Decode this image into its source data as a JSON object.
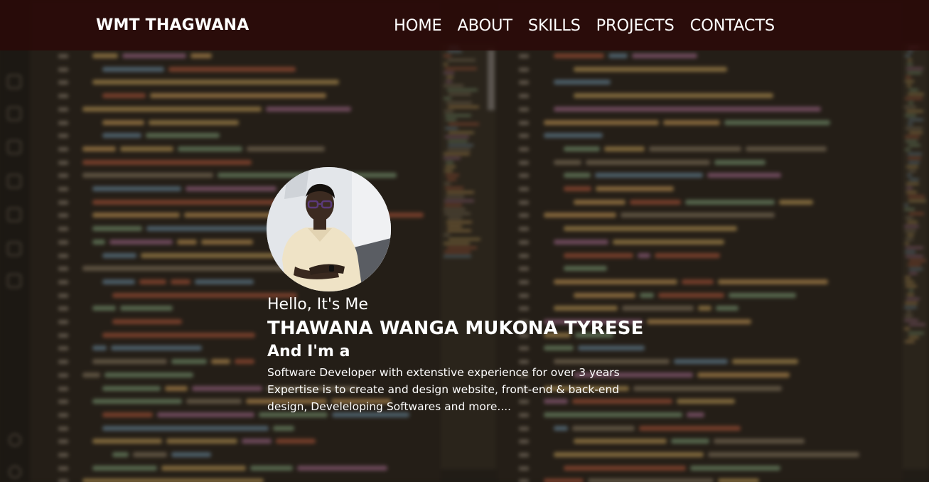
{
  "header": {
    "logo": "WMT THAGWANA",
    "nav": [
      "HOME",
      "ABOUT",
      "SKILLS",
      "PROJECTS",
      "CONTACTS"
    ]
  },
  "profile": {
    "hello": "Hello, It's Me",
    "name": "THAWANA WANGA MUKONA TYRESE",
    "and_im": "And I'm a",
    "description": "Software Developer with extenstive experience for over 3 years Expertise is to create and design website, front-end & back-end design, Develeloping Softwares and more...."
  },
  "colors": {
    "header_bg": "#2b0806",
    "text": "#ffffff",
    "background": "#211c16"
  }
}
